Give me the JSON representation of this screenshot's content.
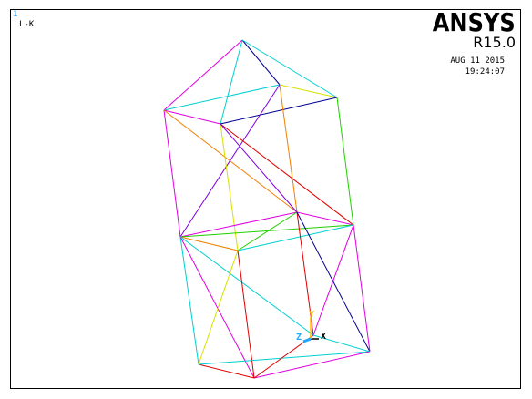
{
  "window_number": "1",
  "plot_label": "L-K",
  "brand": "ANSYS",
  "release": "R15.0",
  "date": "AUG 11 2015",
  "time": "19:24:07",
  "triad": {
    "x_label": "X",
    "y_label": "Y",
    "z_label": "Z",
    "x_color": "#000000",
    "y_color": "#ffbf00",
    "z_color": "#1fa8ff"
  },
  "colors": {
    "background": "#ffffff",
    "border": "#000000",
    "magenta": "#e000e0",
    "cyan": "#00d0d0",
    "blue": "#000090",
    "red": "#e00000",
    "orange": "#f08000",
    "yellow": "#d8e000",
    "green": "#20d000",
    "purple": "#8000e0"
  }
}
